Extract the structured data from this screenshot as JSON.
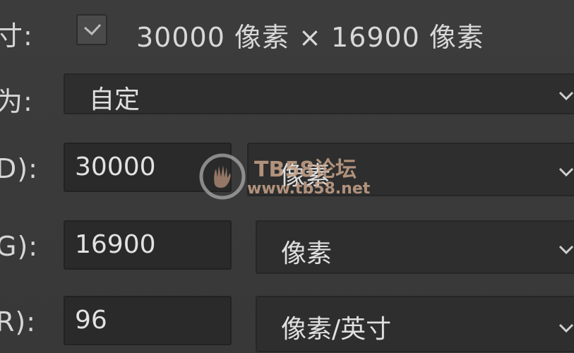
{
  "dialog": {
    "size_row": {
      "label": "寸:",
      "checked": true,
      "summary": "30000 像素 × 16900 像素"
    },
    "preset_row": {
      "label": "为:",
      "value": "自定"
    },
    "width_row": {
      "label": "D):",
      "value": "30000",
      "unit": "像素"
    },
    "height_row": {
      "label": "G):",
      "value": "16900",
      "unit": "像素"
    },
    "resolution_row": {
      "label": "R):",
      "value": "96",
      "unit": "像素/英寸"
    }
  },
  "watermark": {
    "line1": "TB58论坛",
    "line2": "www.tb58.net"
  },
  "icons": {
    "checkbox": "check-icon",
    "dropdown": "chevron-down-icon",
    "watermark_logo": "hand-logo-icon"
  }
}
